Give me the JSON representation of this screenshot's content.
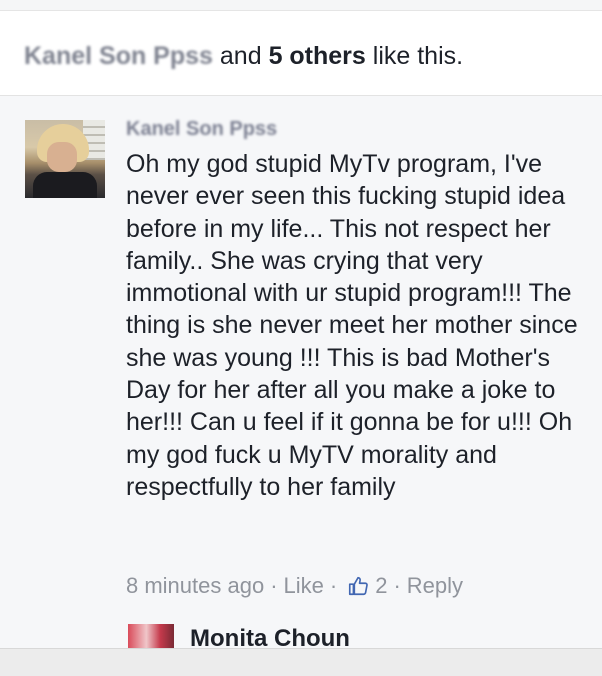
{
  "likes_bar": {
    "liker_name": "Kanel Son Ppss",
    "and_text": " and ",
    "others_count_text": "5 others",
    "suffix_text": " like this."
  },
  "comment": {
    "author": "Kanel Son Ppss",
    "text": "Oh my god stupid MyTv program, I've never ever seen this fucking stupid idea before in my life... This not respect her family.. She was crying that very immotional with ur stupid program!!! The thing is she never meet her mother since she was young !!! This is bad Mother's Day for her after all you make a joke to her!!! Can u feel if it gonna be for u!!! Oh my god fuck u MyTV morality and respectfully to her family",
    "timestamp": "8 minutes ago",
    "separator": "·",
    "like_label": "Like",
    "like_count": "2",
    "reply_label": "Reply"
  },
  "next_comment": {
    "author": "Monita Choun"
  },
  "colors": {
    "meta_gray": "#90949c",
    "text": "#1d2129",
    "comment_bg": "#f6f7f9"
  }
}
